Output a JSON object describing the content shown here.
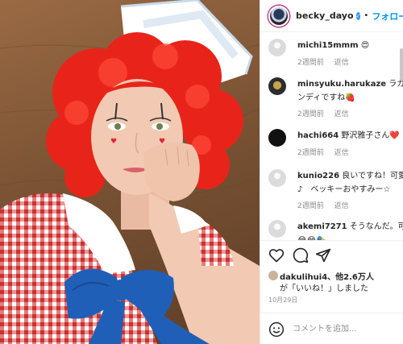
{
  "post": {
    "username": "becky_dayo",
    "follow_label": "フォローす",
    "separator": "•",
    "verified_mark": "✓"
  },
  "comments": [
    {
      "user": "michi15mmm",
      "text": "😍",
      "time": "2週間前",
      "reply": "返信",
      "avatar": "default"
    },
    {
      "user": "minsyuku.harukaze",
      "text": "ラガディ",
      "text2": "ンディですね🍓",
      "time": "2週間前",
      "reply": "返信",
      "avatar": "dark"
    },
    {
      "user": "hachi664",
      "text": "野沢雅子さん❤️",
      "time": "2週間前",
      "reply": "返信",
      "avatar": "black"
    },
    {
      "user": "kunio226",
      "text": "良いですね！可愛い",
      "text2": "♪　ベッキーおやすみー☆",
      "time": "2週間前",
      "reply": "返信",
      "avatar": "default"
    },
    {
      "user": "akemi7271",
      "text": "そうなんだ。可愛",
      "text2": "😂😂🎭",
      "avatar": "default"
    }
  ],
  "likes": {
    "line1": "dakulihui4、他2.6万人",
    "line2": "が「いいね！」しました"
  },
  "date": "10月29日",
  "composer": {
    "placeholder": "コメントを追加..."
  },
  "colors": {
    "link": "#0095f6",
    "muted": "#8e8e8e",
    "wig": "#e8241a",
    "skin": "#f2c9b2",
    "dress_check": "#d94a4a",
    "bow": "#1f5fb8",
    "hat": "#ffffff"
  },
  "icons": {
    "like": "heart-icon",
    "comment": "comment-icon",
    "share": "paper-plane-icon",
    "emoji": "smiley-icon",
    "verified": "verified-badge-icon"
  }
}
